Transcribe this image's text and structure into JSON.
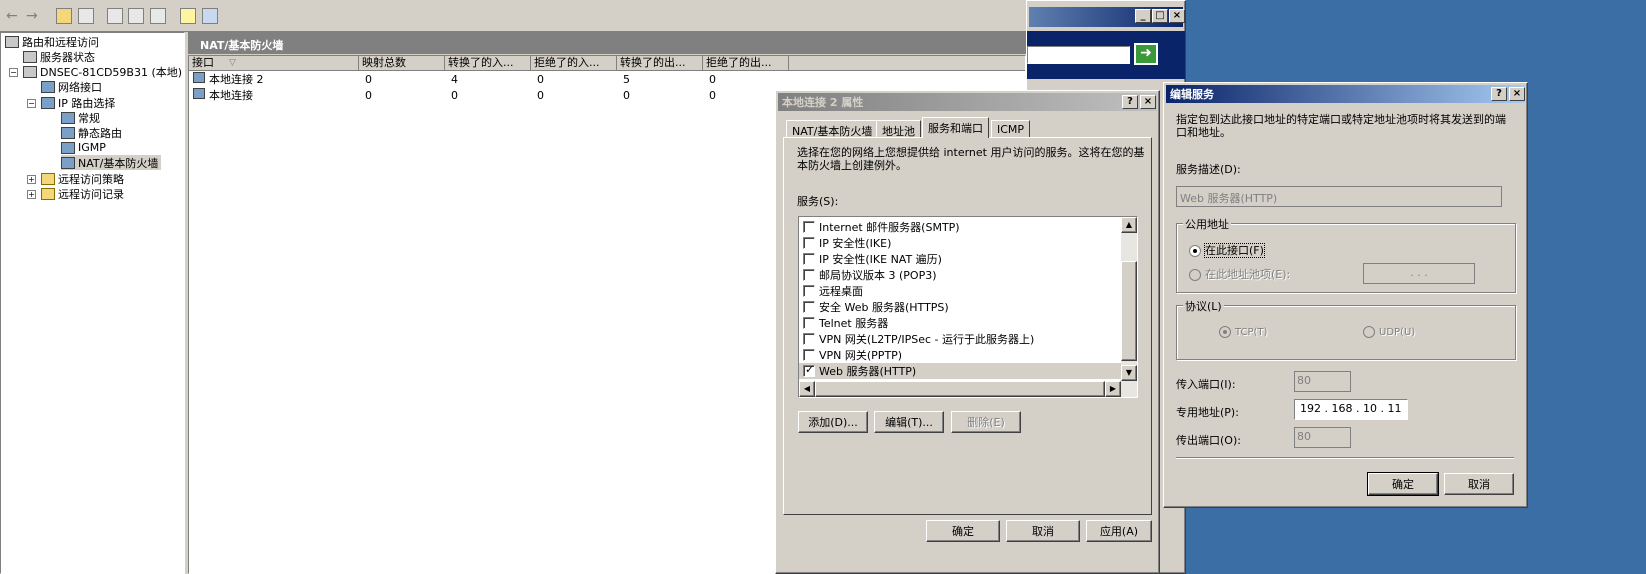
{
  "mmc": {
    "tree": {
      "root": "路由和远程访问",
      "server_status": "服务器状态",
      "server": "DNSEC-81CD59B31 (本地)",
      "net_interfaces": "网络接口",
      "ip_routing": "IP 路由选择",
      "general": "常规",
      "static_routes": "静态路由",
      "igmp": "IGMP",
      "nat": "NAT/基本防火墙",
      "remote_policy": "远程访问策略",
      "remote_log": "远程访问记录"
    },
    "pane_title": "NAT/基本防火墙",
    "columns": [
      "接口",
      "映射总数",
      "转换了的入...",
      "拒绝了的入...",
      "转换了的出...",
      "拒绝了的出..."
    ],
    "rows": [
      {
        "name": "本地连接 2",
        "c1": "0",
        "c2": "4",
        "c3": "0",
        "c4": "5",
        "c5": "0"
      },
      {
        "name": "本地连接",
        "c1": "0",
        "c2": "0",
        "c3": "0",
        "c4": "0",
        "c5": "0"
      }
    ]
  },
  "props": {
    "title": "本地连接 2 属性",
    "help": "?",
    "close": "×",
    "tabs": [
      "NAT/基本防火墙",
      "地址池",
      "服务和端口",
      "ICMP"
    ],
    "desc": "选择在您的网络上您想提供给 internet 用户访问的服务。这将在您的基本防火墙上创建例外。",
    "services_label": "服务(S):",
    "services": [
      {
        "label": "Internet 邮件服务器(SMTP)",
        "checked": false
      },
      {
        "label": "IP 安全性(IKE)",
        "checked": false
      },
      {
        "label": "IP 安全性(IKE NAT 遍历)",
        "checked": false
      },
      {
        "label": "邮局协议版本 3 (POP3)",
        "checked": false
      },
      {
        "label": "远程桌面",
        "checked": false
      },
      {
        "label": "安全 Web 服务器(HTTPS)",
        "checked": false
      },
      {
        "label": "Telnet 服务器",
        "checked": false
      },
      {
        "label": "VPN 网关(L2TP/IPSec - 运行于此服务器上)",
        "checked": false
      },
      {
        "label": "VPN 网关(PPTP)",
        "checked": false
      },
      {
        "label": "Web 服务器(HTTP)",
        "checked": true
      }
    ],
    "add": "添加(D)...",
    "edit": "编辑(T)...",
    "delete": "删除(E)",
    "ok": "确定",
    "cancel": "取消",
    "apply": "应用(A)"
  },
  "edit": {
    "title": "编辑服务",
    "help": "?",
    "close": "×",
    "desc": "指定包到达此接口地址的特定端口或特定地址池项时将其发送到的端口和地址。",
    "svc_desc_label": "服务描述(D):",
    "svc_desc_value": "Web 服务器(HTTP)",
    "public_addr": "公用地址",
    "on_iface": "在此接口(F)",
    "on_pool": "在此地址池项(E):",
    "pool_ip": ".     .     .",
    "protocol": "协议(L)",
    "tcp": "TCP(T)",
    "udp": "UDP(U)",
    "in_port_label": "传入端口(I):",
    "in_port": "80",
    "private_label": "专用地址(P):",
    "private_addr": "192 . 168 . 10 . 11",
    "out_port_label": "传出端口(O):",
    "out_port": "80",
    "ok": "确定",
    "cancel": "取消"
  },
  "bg_window": {
    "min": "_",
    "max": "□",
    "close": "×",
    "go": "➜"
  }
}
